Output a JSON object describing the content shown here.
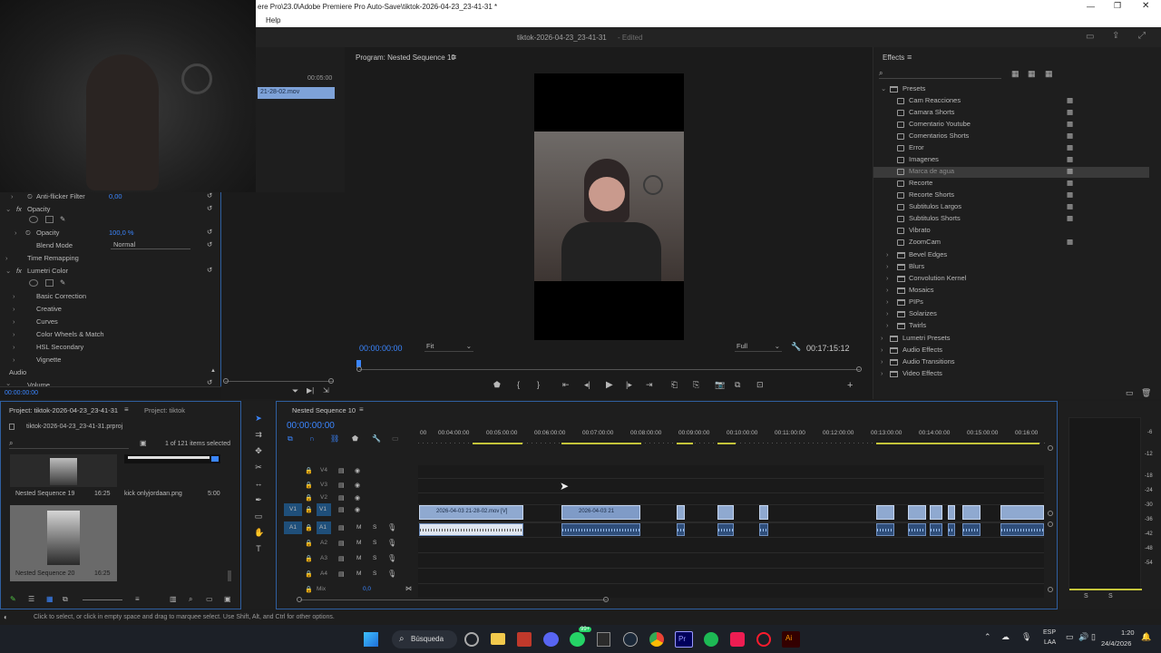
{
  "window": {
    "title": "ere Pro\\23.0\\Adobe Premiere Pro Auto-Save\\tiktok-2026-04-23_23-41-31 *",
    "menu_help": "Help",
    "project_title": "tiktok-2026-04-23_23-41-31",
    "edited_label": "- Edited"
  },
  "source_panel": {
    "timecode": "00:05:00",
    "clip_label": "21-28-02.mov"
  },
  "effect_controls": {
    "anti_flicker_label": "Anti-flicker Filter",
    "anti_flicker_value": "0,00",
    "opacity_section": "Opacity",
    "opacity_label": "Opacity",
    "opacity_value": "100,0 %",
    "blend_mode_label": "Blend Mode",
    "blend_mode_value": "Normal",
    "time_remapping": "Time Remapping",
    "lumetri_color": "Lumetri Color",
    "lumetri_items": [
      "Basic Correction",
      "Creative",
      "Curves",
      "Color Wheels & Match",
      "HSL Secondary",
      "Vignette"
    ],
    "audio_label": "Audio",
    "volume_label": "Volume",
    "bottom_timecode": "00:00:00:00"
  },
  "program_monitor": {
    "title": "Program: Nested Sequence 10",
    "timecode": "00:00:00:00",
    "zoom": "Fit",
    "quality": "Full",
    "duration": "00:17:15:12"
  },
  "effects_panel": {
    "title": "Effects",
    "presets_label": "Presets",
    "presets": [
      "Cam Reacciones",
      "Camara Shorts",
      "Comentario Youtube",
      "Comentarios Shorts",
      "Error",
      "Imagenes",
      "Marca de agua",
      "Recorte",
      "Recorte Shorts",
      "Subtitulos Largos",
      "Subtitulos Shorts",
      "Vibrato",
      "ZoomCam"
    ],
    "selected_preset": "Marca de agua",
    "categories": [
      "Bevel Edges",
      "Blurs",
      "Convolution Kernel",
      "Mosaics",
      "PIPs",
      "Solarizes",
      "Twirls"
    ],
    "top_folders": [
      "Lumetri Presets",
      "Audio Effects",
      "Audio Transitions",
      "Video Effects"
    ]
  },
  "project_panel": {
    "tab_active": "Project: tiktok-2026-04-23_23-41-31",
    "tab_other": "Project: tiktok",
    "file_name": "tiktok-2026-04-23_23-41-31.prproj",
    "items_selected": "1 of 121 items selected",
    "items": [
      {
        "name": "Nested Sequence 19",
        "duration": "16:25"
      },
      {
        "name": "kick onlyjordaan.png",
        "duration": "5:00"
      },
      {
        "name": "Nested Sequence 20",
        "duration": "16:25"
      }
    ]
  },
  "timeline": {
    "tab": "Nested Sequence 10",
    "timecode": "00:00:00:00",
    "ruler": [
      "00",
      "00:04:00:00",
      "00:05:00:00",
      "00:06:00:00",
      "00:07:00:00",
      "00:08:00:00",
      "00:09:00:00",
      "00:10:00:00",
      "00:11:00:00",
      "00:12:00:00",
      "00:13:00:00",
      "00:14:00:00",
      "00:15:00:00",
      "00:16:00"
    ],
    "video_tracks": [
      "V4",
      "V3",
      "V2",
      "V1"
    ],
    "audio_tracks": [
      "A1",
      "A2",
      "A3",
      "A4"
    ],
    "mix_label": "Mix",
    "mix_value": "0,0",
    "clip_v1_label": "2026-04-03 21-28-02.mov [V]",
    "clip_v2_label": "2026-04-03 21",
    "track_m": "M",
    "track_s": "S"
  },
  "meters": {
    "scale": [
      "-6",
      "-12",
      "-18",
      "-24",
      "-30",
      "-36",
      "-42",
      "-48",
      "-54"
    ],
    "solo_l": "S",
    "solo_r": "S"
  },
  "status_bar": {
    "text": "Click to select, or click in empty space and drag to marquee select. Use Shift, Alt, and Ctrl for other options."
  },
  "taskbar": {
    "search_label": "Búsqueda",
    "lang_top": "ESP",
    "lang_bottom": "LAA",
    "time": "1:20",
    "date": "24/4/2026",
    "badge": "99+"
  },
  "colors": {
    "accent": "#3b86ff",
    "clip_video": "#8fa9d0",
    "clip_audio": "#2f4e7a",
    "track_active": "#1f4f7a"
  }
}
